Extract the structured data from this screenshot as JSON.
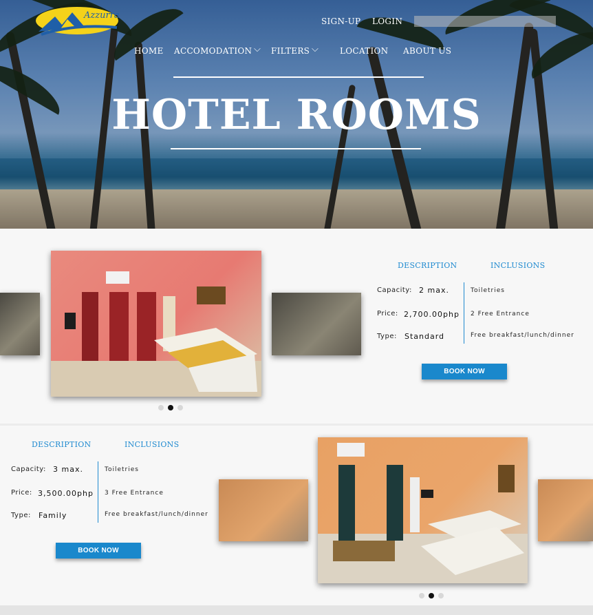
{
  "brand": {
    "logo_text": "Azzurra"
  },
  "topnav": {
    "signup": "SIGN-UP",
    "login": "LOGIN",
    "search_placeholder": ""
  },
  "mainnav": {
    "home": "HOME",
    "accomodation": "ACCOMODATION",
    "filters": "FILTERS",
    "location": "LOCATION",
    "about": "ABOUT US"
  },
  "hero": {
    "title": "HOTEL ROOMS"
  },
  "rooms": [
    {
      "tabs": {
        "description": "DESCRIPTION",
        "inclusions": "INCLUSIONS"
      },
      "capacity_label": "Capacity:",
      "capacity": "2 max.",
      "price_label": "Price:",
      "price": "2,700.00php",
      "type_label": "Type:",
      "type": "Standard",
      "inclusions": [
        "Toiletries",
        "2 Free Entrance",
        "Free breakfast/lunch/dinner"
      ],
      "book_label": "BOOK NOW",
      "carousel_index": 2,
      "carousel_count": 3
    },
    {
      "tabs": {
        "description": "DESCRIPTION",
        "inclusions": "INCLUSIONS"
      },
      "capacity_label": "Capacity:",
      "capacity": "3 max.",
      "price_label": "Price:",
      "price": "3,500.00php",
      "type_label": "Type:",
      "type": "Family",
      "inclusions": [
        "Toiletries",
        "3 Free Entrance",
        "Free breakfast/lunch/dinner"
      ],
      "book_label": "BOOK NOW",
      "carousel_index": 2,
      "carousel_count": 3
    }
  ],
  "colors": {
    "accent": "#1a88cc",
    "tab_text": "#1f8ad0"
  }
}
